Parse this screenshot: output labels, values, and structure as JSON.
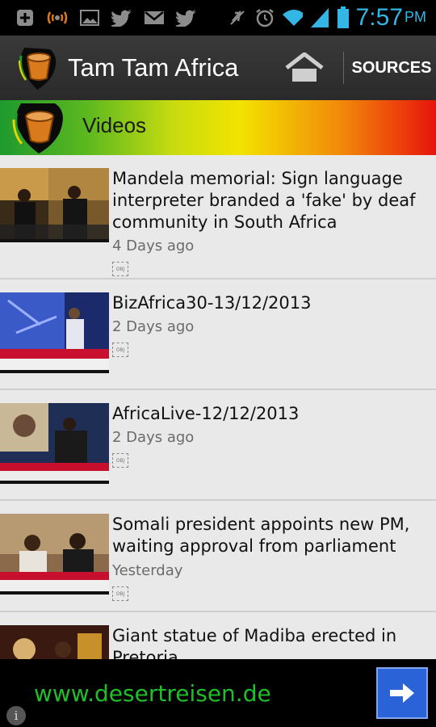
{
  "status_bar": {
    "icons_left": [
      "plus-icon",
      "radio-icon",
      "picture-icon",
      "twitter-icon",
      "gmail-icon",
      "twitter-icon"
    ],
    "icons_right": [
      "mute-icon",
      "alarm-icon",
      "wifi-icon",
      "signal-icon",
      "battery-icon"
    ],
    "time": "7:57",
    "ampm": "PM"
  },
  "action_bar": {
    "title": "Tam Tam Africa",
    "home_icon": "home-icon",
    "sources_label": "SOURCES"
  },
  "banner": {
    "label": "Videos"
  },
  "colors": {
    "accent_time": "#33b5e5",
    "ad_url": "#1fbf2a",
    "ad_button": "#2a63d8"
  },
  "videos": [
    {
      "title": "Mandela memorial: Sign language interpreter branded a 'fake' by deaf community in South Africa",
      "time": "4 Days ago",
      "badge": "OBJ"
    },
    {
      "title": "BizAfrica30-13/12/2013",
      "time": "2 Days ago",
      "badge": "OBJ"
    },
    {
      "title": "AfricaLive-12/12/2013",
      "time": "2 Days ago",
      "badge": "OBJ"
    },
    {
      "title": "Somali president appoints new PM, waiting approval from parliament",
      "time": "Yesterday",
      "badge": "OBJ"
    },
    {
      "title": "Giant statue of Madiba erected in Pretoria",
      "time": "",
      "badge": ""
    }
  ],
  "ad": {
    "url": "www.desertreisen.de",
    "info": "i"
  }
}
